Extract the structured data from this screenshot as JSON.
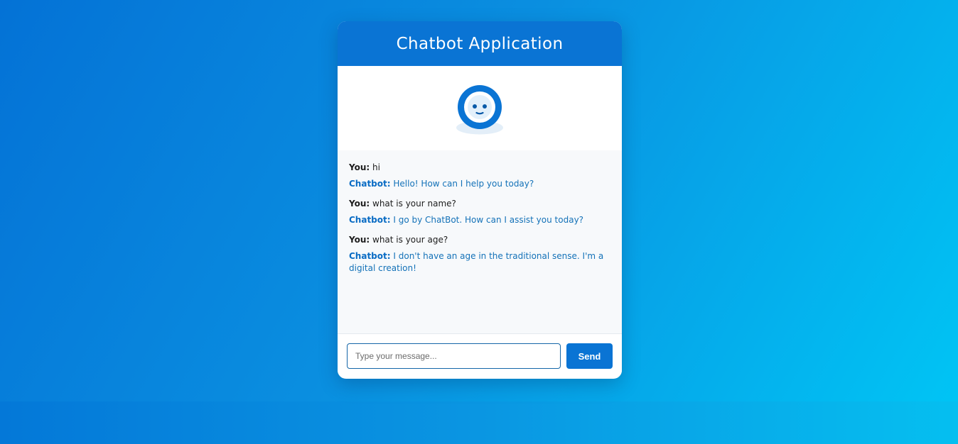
{
  "app": {
    "title": "Chatbot Application",
    "avatar_icon": "robot-icon"
  },
  "conversation": [
    {
      "user": {
        "sender": "You:",
        "text": "hi"
      },
      "bot": {
        "sender": "Chatbot:",
        "text": "Hello! How can I help you today?"
      }
    },
    {
      "user": {
        "sender": "You:",
        "text": "what is your name?"
      },
      "bot": {
        "sender": "Chatbot:",
        "text": "I go by ChatBot. How can I assist you today?"
      }
    },
    {
      "user": {
        "sender": "You:",
        "text": "what is your age?"
      },
      "bot": {
        "sender": "Chatbot:",
        "text": "I don't have an age in the traditional sense. I'm a digital creation!"
      }
    }
  ],
  "composer": {
    "placeholder": "Type your message...",
    "value": "",
    "send_label": "Send"
  },
  "colors": {
    "accent": "#0a74d4",
    "bot_text": "#1472b8",
    "background_start": "#0472d6",
    "background_end": "#00c6f5"
  }
}
